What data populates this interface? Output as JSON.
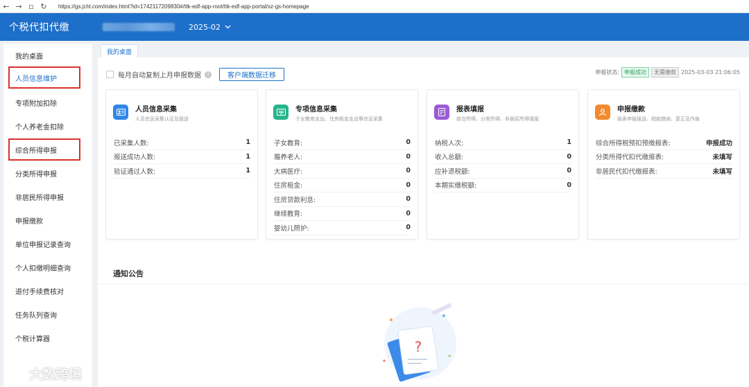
{
  "browser": {
    "url": "https://gs.jchl.com/index.html?id=1742117209830#/ttk-edf-app-root/ttk-edf-app-portal/sz-gs-homepage"
  },
  "header": {
    "app_title": "个税代扣代缴",
    "period": "2025-02",
    "period_icon": "chevron-down-icon"
  },
  "sidebar": {
    "items": [
      {
        "label": "我的桌面"
      },
      {
        "label": "人员信息维护",
        "highlighted": true
      },
      {
        "label": "专项附加扣除"
      },
      {
        "label": "个人养老金扣除"
      },
      {
        "label": "综合所得申报",
        "highlighted": true
      },
      {
        "label": "分类所得申报"
      },
      {
        "label": "非居民所得申报"
      },
      {
        "label": "申报缴款"
      },
      {
        "label": "单位申报记录查询"
      },
      {
        "label": "个人扣缴明细查询"
      },
      {
        "label": "退付手续费核对"
      },
      {
        "label": "任务队列查询"
      },
      {
        "label": "个税计算器"
      }
    ]
  },
  "tabs": [
    {
      "label": "我的桌面"
    }
  ],
  "toolbar": {
    "auto_copy_label": "每月自动复制上月申报数据",
    "migrate_button": "客户端数据迁移"
  },
  "status": {
    "label": "申报状态:",
    "success_tag": "申报成功",
    "none_tag": "无需缴款",
    "timestamp": "2025-03-03 21:06:05"
  },
  "cards": [
    {
      "title": "人员信息采集",
      "subtitle": "人员信息采集认证及报送",
      "icon": "id-card-icon",
      "color": "#2f86e6",
      "rows": [
        {
          "label": "已采集人数:",
          "value": "1"
        },
        {
          "label": "报送成功人数:",
          "value": "1"
        },
        {
          "label": "验证通过人数:",
          "value": "1"
        }
      ]
    },
    {
      "title": "专项信息采集",
      "subtitle": "子女教育支出、住房租金支出等信息采集",
      "icon": "certificate-icon",
      "color": "#26b48e",
      "rows": [
        {
          "label": "子女教育:",
          "value": "0"
        },
        {
          "label": "赡养老人:",
          "value": "0"
        },
        {
          "label": "大病医疗:",
          "value": "0"
        },
        {
          "label": "住房租金:",
          "value": "0"
        },
        {
          "label": "住房贷款利息:",
          "value": "0"
        },
        {
          "label": "继续教育:",
          "value": "0"
        },
        {
          "label": "婴幼儿照护:",
          "value": "0"
        }
      ]
    },
    {
      "title": "报表填报",
      "subtitle": "综合所得、分类所得、非居民所得填报",
      "icon": "form-icon",
      "color": "#9b5bd6",
      "rows": [
        {
          "label": "纳税人次:",
          "value": "1"
        },
        {
          "label": "收入总额:",
          "value": "0"
        },
        {
          "label": "应补退税额:",
          "value": "0"
        },
        {
          "label": "本期实缴税额:",
          "value": "0"
        }
      ]
    },
    {
      "title": "申报缴款",
      "subtitle": "报表申报报送、税款缴纳、更正及作废",
      "icon": "user-tax-icon",
      "color": "#f28a2e",
      "rows": [
        {
          "label": "综合所得税预扣预缴报表:",
          "value": "申报成功"
        },
        {
          "label": "分类所得代扣代缴报表:",
          "value": "未填写"
        },
        {
          "label": "非居民代扣代缴报表:",
          "value": "未填写"
        }
      ]
    }
  ],
  "notice": {
    "title": "通知公告",
    "empty_icon": "empty-document-question-icon"
  },
  "watermark": {
    "text": "大数跨境"
  }
}
